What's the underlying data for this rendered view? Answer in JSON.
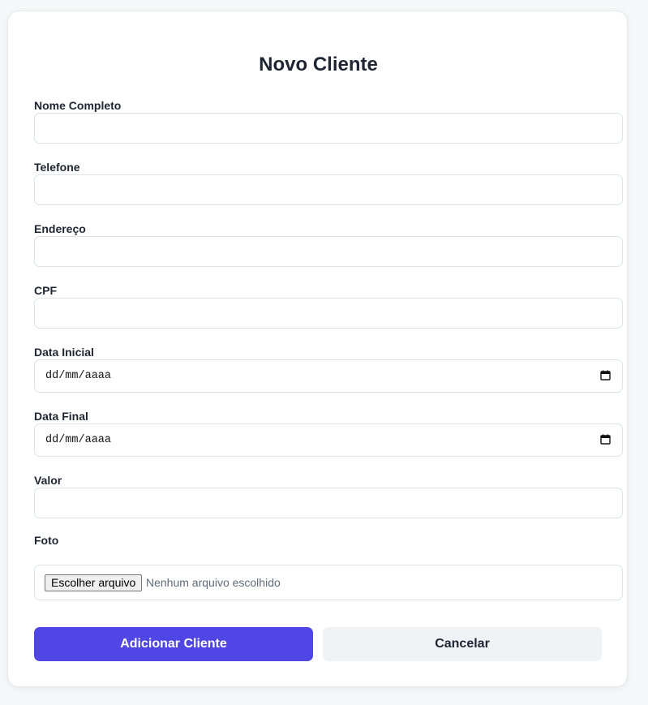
{
  "form": {
    "title": "Novo Cliente",
    "fields": [
      {
        "label": "Nome Completo",
        "value": ""
      },
      {
        "label": "Telefone",
        "value": ""
      },
      {
        "label": "Endereço",
        "value": ""
      },
      {
        "label": "CPF",
        "value": ""
      },
      {
        "label": "Data Inicial",
        "placeholder": "dd/mm/aaaa"
      },
      {
        "label": "Data Final",
        "placeholder": "dd/mm/aaaa"
      },
      {
        "label": "Valor",
        "value": ""
      },
      {
        "label": "Foto",
        "button": "Escolher arquivo",
        "status": "Nenhum arquivo escolhido"
      }
    ],
    "submit_label": "Adicionar Cliente",
    "cancel_label": "Cancelar"
  },
  "icons": {
    "date": "calendar-icon"
  },
  "colors": {
    "primary": "#4f46e5",
    "secondary": "#f0f2f6",
    "text": "#1e2533"
  }
}
